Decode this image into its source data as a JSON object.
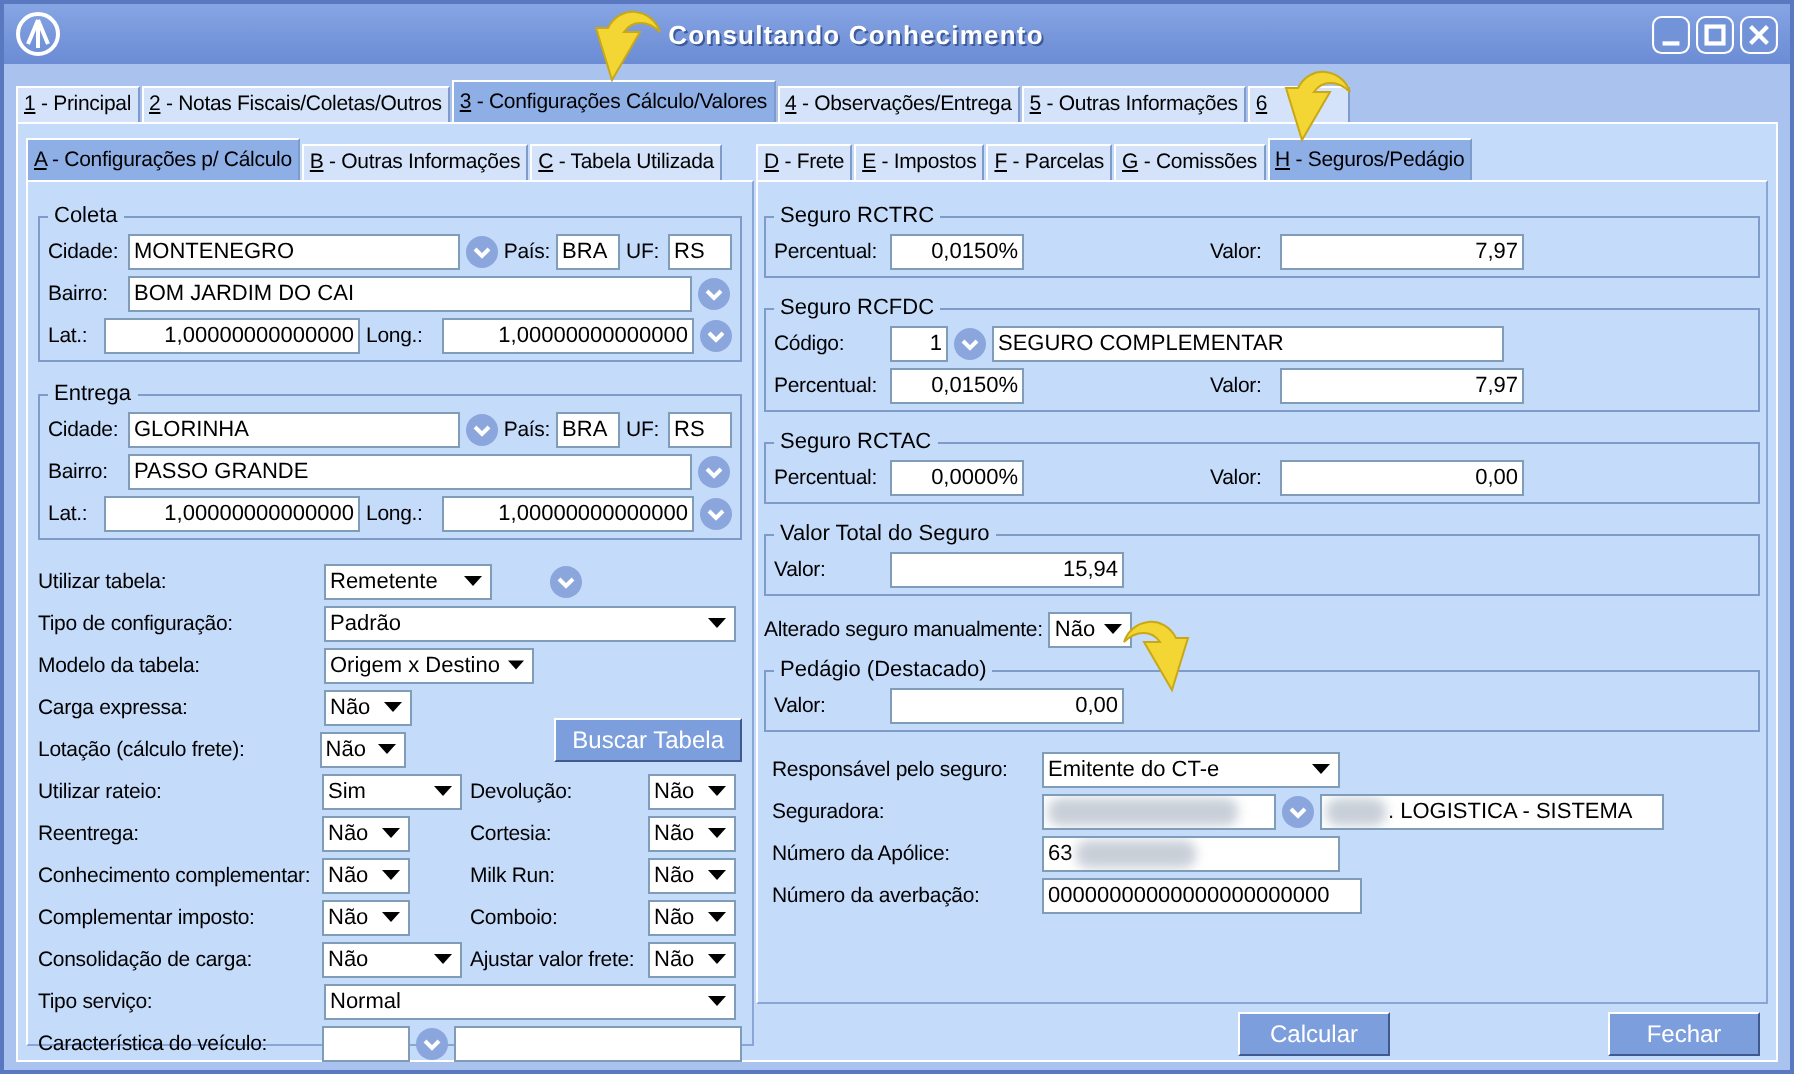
{
  "window": {
    "title": "Consultando Conhecimento"
  },
  "tabs": [
    {
      "label": "1 - Principal",
      "selected": false
    },
    {
      "label": "2 - Notas Fiscais/Coletas/Outros",
      "selected": false
    },
    {
      "label": "3 - Configurações Cálculo/Valores",
      "selected": true
    },
    {
      "label": "4 - Observações/Entrega",
      "selected": false
    },
    {
      "label": "5 - Outras Informações",
      "selected": false
    },
    {
      "label": "6",
      "selected": false
    }
  ],
  "calc_tabs": [
    {
      "label": "A - Configurações p/ Cálculo",
      "selected": true
    },
    {
      "label": "B - Outras Informações",
      "selected": false
    },
    {
      "label": "C - Tabela Utilizada",
      "selected": false
    }
  ],
  "value_tabs": [
    {
      "label": "D - Frete",
      "selected": false
    },
    {
      "label": "E - Impostos",
      "selected": false
    },
    {
      "label": "F - Parcelas",
      "selected": false
    },
    {
      "label": "G - Comissões",
      "selected": false
    },
    {
      "label": "H - Seguros/Pedágio",
      "selected": true
    }
  ],
  "locations": [
    {
      "title": "Coleta",
      "cidade_label": "Cidade:",
      "cidade": "MONTENEGRO",
      "pais_label": "País:",
      "pais": "BRA",
      "uf_label": "UF:",
      "uf": "RS",
      "bairro_label": "Bairro:",
      "bairro": "BOM JARDIM DO CAI",
      "lat_label": "Lat.:",
      "lat": "1,00000000000000",
      "long_label": "Long.:",
      "long": "1,00000000000000"
    },
    {
      "title": "Entrega",
      "cidade_label": "Cidade:",
      "cidade": "GLORINHA",
      "pais_label": "País:",
      "pais": "BRA",
      "uf_label": "UF:",
      "uf": "RS",
      "bairro_label": "Bairro:",
      "bairro": "PASSO GRANDE",
      "lat_label": "Lat.:",
      "lat": "1,00000000000000",
      "long_label": "Long.:",
      "long": "1,00000000000000"
    }
  ],
  "options": [
    {
      "kind": "select-lookup",
      "label": "Utilizar tabela:",
      "value": "Remetente"
    },
    {
      "kind": "select",
      "label": "Tipo de configuração:",
      "value": "Padrão"
    },
    {
      "kind": "select",
      "label": "Modelo da tabela:",
      "value": "Origem x Destino"
    },
    {
      "kind": "select",
      "label": "Carga expressa:",
      "value": "Não"
    },
    {
      "kind": "select-button",
      "label": "Lotação (cálculo frete):",
      "value": "Não",
      "button": "Buscar Tabela"
    },
    {
      "kind": "pair",
      "label": "Utilizar rateio:",
      "value": "Sim",
      "label_2": "Devolução:",
      "value_2": "Não"
    },
    {
      "kind": "pair",
      "label": "Reentrega:",
      "value": "Não",
      "label_2": "Cortesia:",
      "value_2": "Não"
    },
    {
      "kind": "pair",
      "label": "Conhecimento complementar:",
      "value": "Não",
      "label_2": "Milk Run:",
      "value_2": "Não"
    },
    {
      "kind": "pair",
      "label": "Complementar imposto:",
      "value": "Não",
      "label_2": "Comboio:",
      "value_2": "Não"
    },
    {
      "kind": "pair",
      "label": "Consolidação de carga:",
      "value": "Não",
      "label_2": "Ajustar valor frete:",
      "value_2": "Não"
    },
    {
      "kind": "select",
      "label": "Tipo serviço:",
      "value": "Normal"
    },
    {
      "kind": "lookup-input",
      "label": "Característica do veículo:"
    }
  ],
  "seguros": [
    {
      "kind": "rate",
      "title": "Seguro RCTRC",
      "percentual_label": "Percentual:",
      "percentual": "0,0150%",
      "valor_label": "Valor:",
      "valor": "7,97"
    },
    {
      "kind": "code-rate",
      "title": "Seguro RCFDC",
      "codigo_label": "Código:",
      "codigo": "1",
      "descricao": "SEGURO COMPLEMENTAR",
      "percentual_label": "Percentual:",
      "percentual": "0,0150%",
      "valor_label": "Valor:",
      "valor": "7,97"
    },
    {
      "kind": "rate",
      "title": "Seguro RCTAC",
      "percentual_label": "Percentual:",
      "percentual": "0,0000%",
      "valor_label": "Valor:",
      "valor": "0,00"
    },
    {
      "kind": "total",
      "title": "Valor Total do Seguro",
      "valor_label": "Valor:",
      "valor": "15,94"
    }
  ],
  "alterado": {
    "label": "Alterado seguro manualmente:",
    "value": "Não"
  },
  "pedagio": {
    "title": "Pedágio (Destacado)",
    "valor_label": "Valor:",
    "valor": "0,00"
  },
  "responsavel": {
    "label": "Responsável pelo seguro:",
    "value": "Emitente do CT-e"
  },
  "seguradora": {
    "label": "Seguradora:",
    "name": ". LOGISTICA - SISTEMA"
  },
  "apolice": {
    "label": "Número da Apólice:",
    "value": "63"
  },
  "averbacao": {
    "label": "Número da averbação:",
    "value": "00000000000000000000000"
  },
  "buttons": [
    {
      "label": "Calcular"
    },
    {
      "label": "Fechar"
    }
  ]
}
